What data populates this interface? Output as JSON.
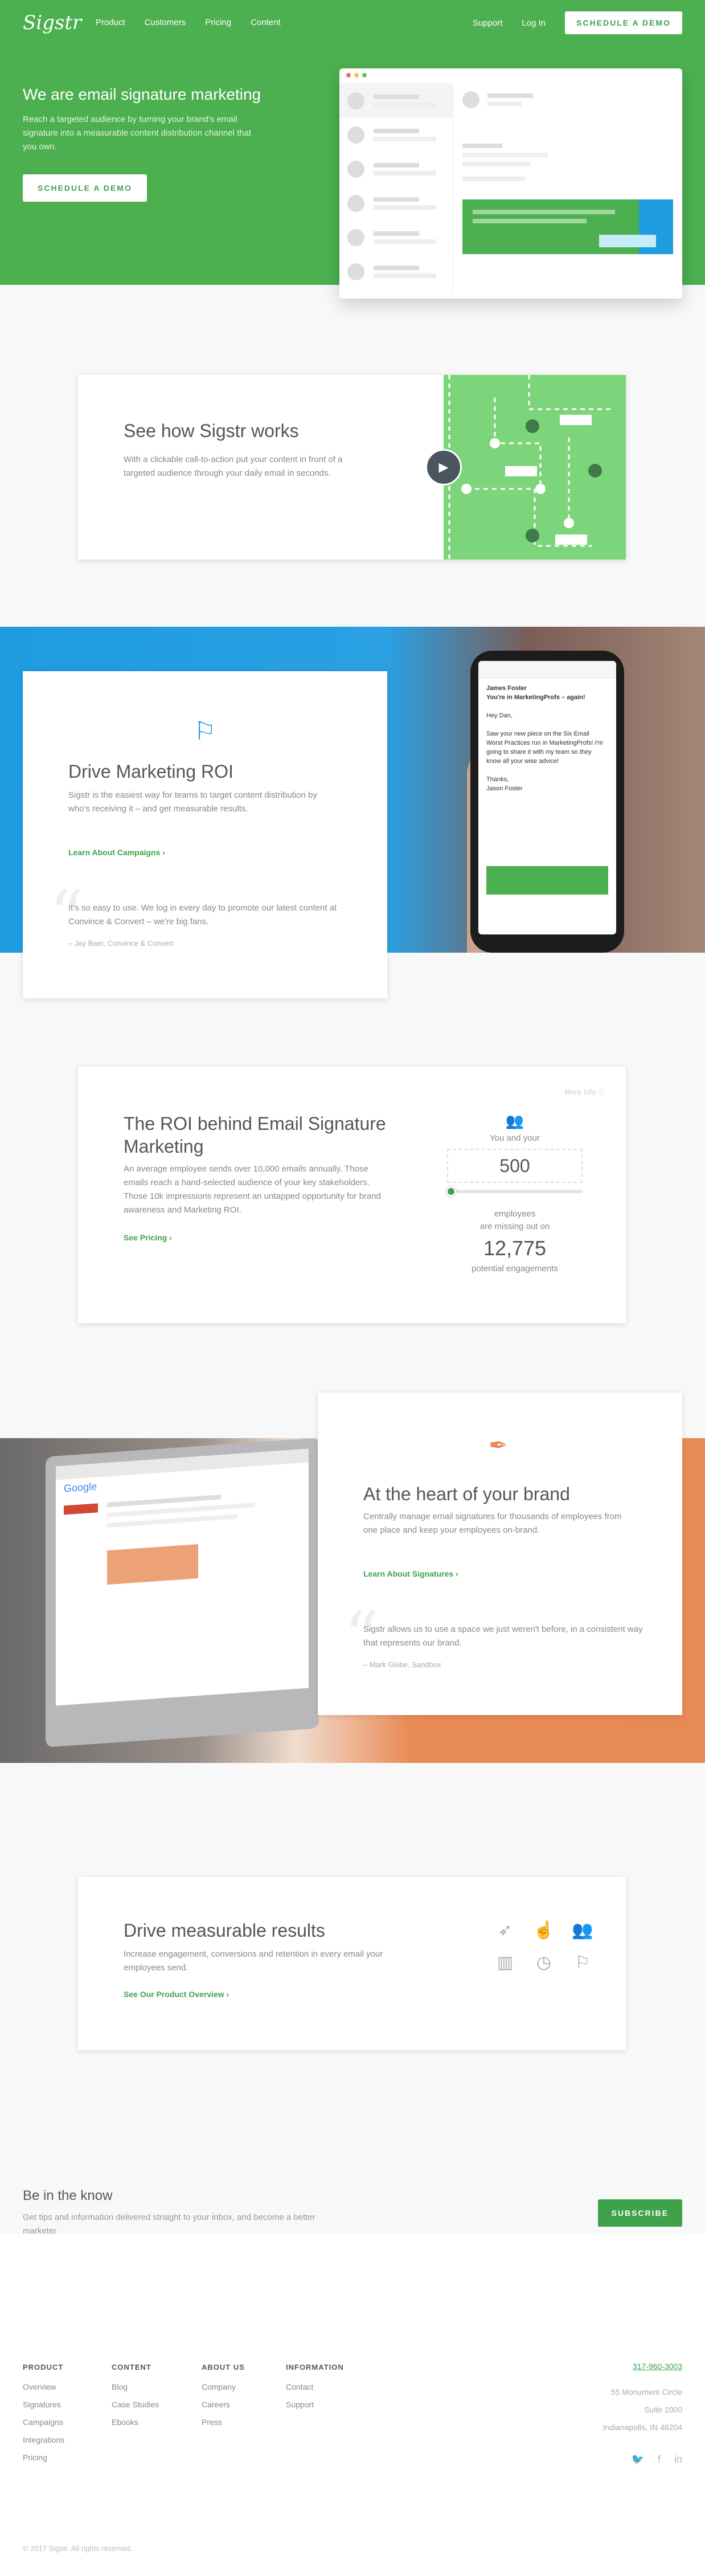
{
  "nav": {
    "logo": "Sigstr",
    "links": [
      "Product",
      "Customers",
      "Pricing",
      "Content"
    ],
    "support": "Support",
    "login": "Log In",
    "cta": "SCHEDULE A DEMO"
  },
  "hero": {
    "title": "We are email signature marketing",
    "subtitle": "Reach a targeted audience by turning your brand's email signature into a measurable content distribution channel that you own.",
    "cta": "SCHEDULE A DEMO"
  },
  "see_how": {
    "title": "See how Sigstr works",
    "text": "With a clickable call-to-action put your content in front of a targeted audience through your daily email in seconds."
  },
  "drive_roi": {
    "title": "Drive Marketing ROI",
    "text": "Sigstr is the easiest way for teams to target content distribution by who's receiving it – and get measurable results.",
    "link": "Learn About Campaigns",
    "quote": "It's so easy to use. We log in every day to promote our latest content at Convince & Convert – we're big fans.",
    "quote_source": "– Jay Baer, Convince & Convert",
    "phone_email": {
      "from": "James Foster",
      "subject": "You're in MarketingProfs – again!",
      "greeting": "Hey Dan,",
      "body": "Saw your new piece on the Six Email Worst Practices run in MarketingProfs! I'm going to share it with my team so they know all your wise advice!",
      "signoff": "Thanks,",
      "name": "Jason Foster"
    }
  },
  "roi_calc": {
    "more_info": "More Info",
    "title": "The ROI behind Email Signature Marketing",
    "text": "An average employee sends over 10,000 emails annually. Those emails reach a hand-selected audience of your key stakeholders. Those 10k impressions represent an untapped opportunity for brand awareness and Marketing ROI.",
    "link": "See Pricing",
    "you_and_your": "You and your",
    "employees_value": "500",
    "slider_fraction": 0.03,
    "missing_line1": "employees",
    "missing_line2": "are missing out on",
    "engagements_value": "12,775",
    "engagements_label": "potential engagements"
  },
  "brand": {
    "title": "At the heart of your brand",
    "text": "Centrally manage email signatures for thousands of employees from one place and keep your employees on-brand.",
    "link": "Learn About Signatures",
    "quote": "Sigstr allows us to use a space we just weren't before, in a consistent way that represents our brand.",
    "quote_source": "– Mark Globe, Sandbox",
    "laptop_search_brand": "Google"
  },
  "measurable": {
    "title": "Drive measurable results",
    "text": "Increase engagement, conversions and retention in every email your employees send.",
    "link": "See Our Product Overview",
    "icons": [
      "cursor-icon",
      "hand-pointer-icon",
      "users-icon",
      "bar-chart-icon",
      "clock-icon",
      "flag-icon"
    ]
  },
  "newsletter": {
    "title": "Be in the know",
    "text": "Get tips and information delivered straight to your inbox, and become a better marketer",
    "cta": "SUBSCRIBE"
  },
  "footer": {
    "product": {
      "heading": "PRODUCT",
      "items": [
        "Overview",
        "Signatures",
        "Campaigns",
        "Integrations",
        "Pricing"
      ]
    },
    "content": {
      "heading": "CONTENT",
      "items": [
        "Blog",
        "Case Studies",
        "Ebooks"
      ]
    },
    "about": {
      "heading": "ABOUT US",
      "items": [
        "Company",
        "Careers",
        "Press"
      ]
    },
    "information": {
      "heading": "INFORMATION",
      "items": [
        "Contact",
        "Support"
      ]
    },
    "phone": "317-960-3003",
    "address": [
      "55 Monument Circle",
      "Suite 1000",
      "Indianapolis, IN 46204"
    ],
    "copyright": "© 2017 Sigstr. All rights reserved."
  },
  "colors": {
    "brand_green": "#4cb050",
    "accent_blue": "#1f9be0",
    "accent_orange": "#e88a55"
  }
}
